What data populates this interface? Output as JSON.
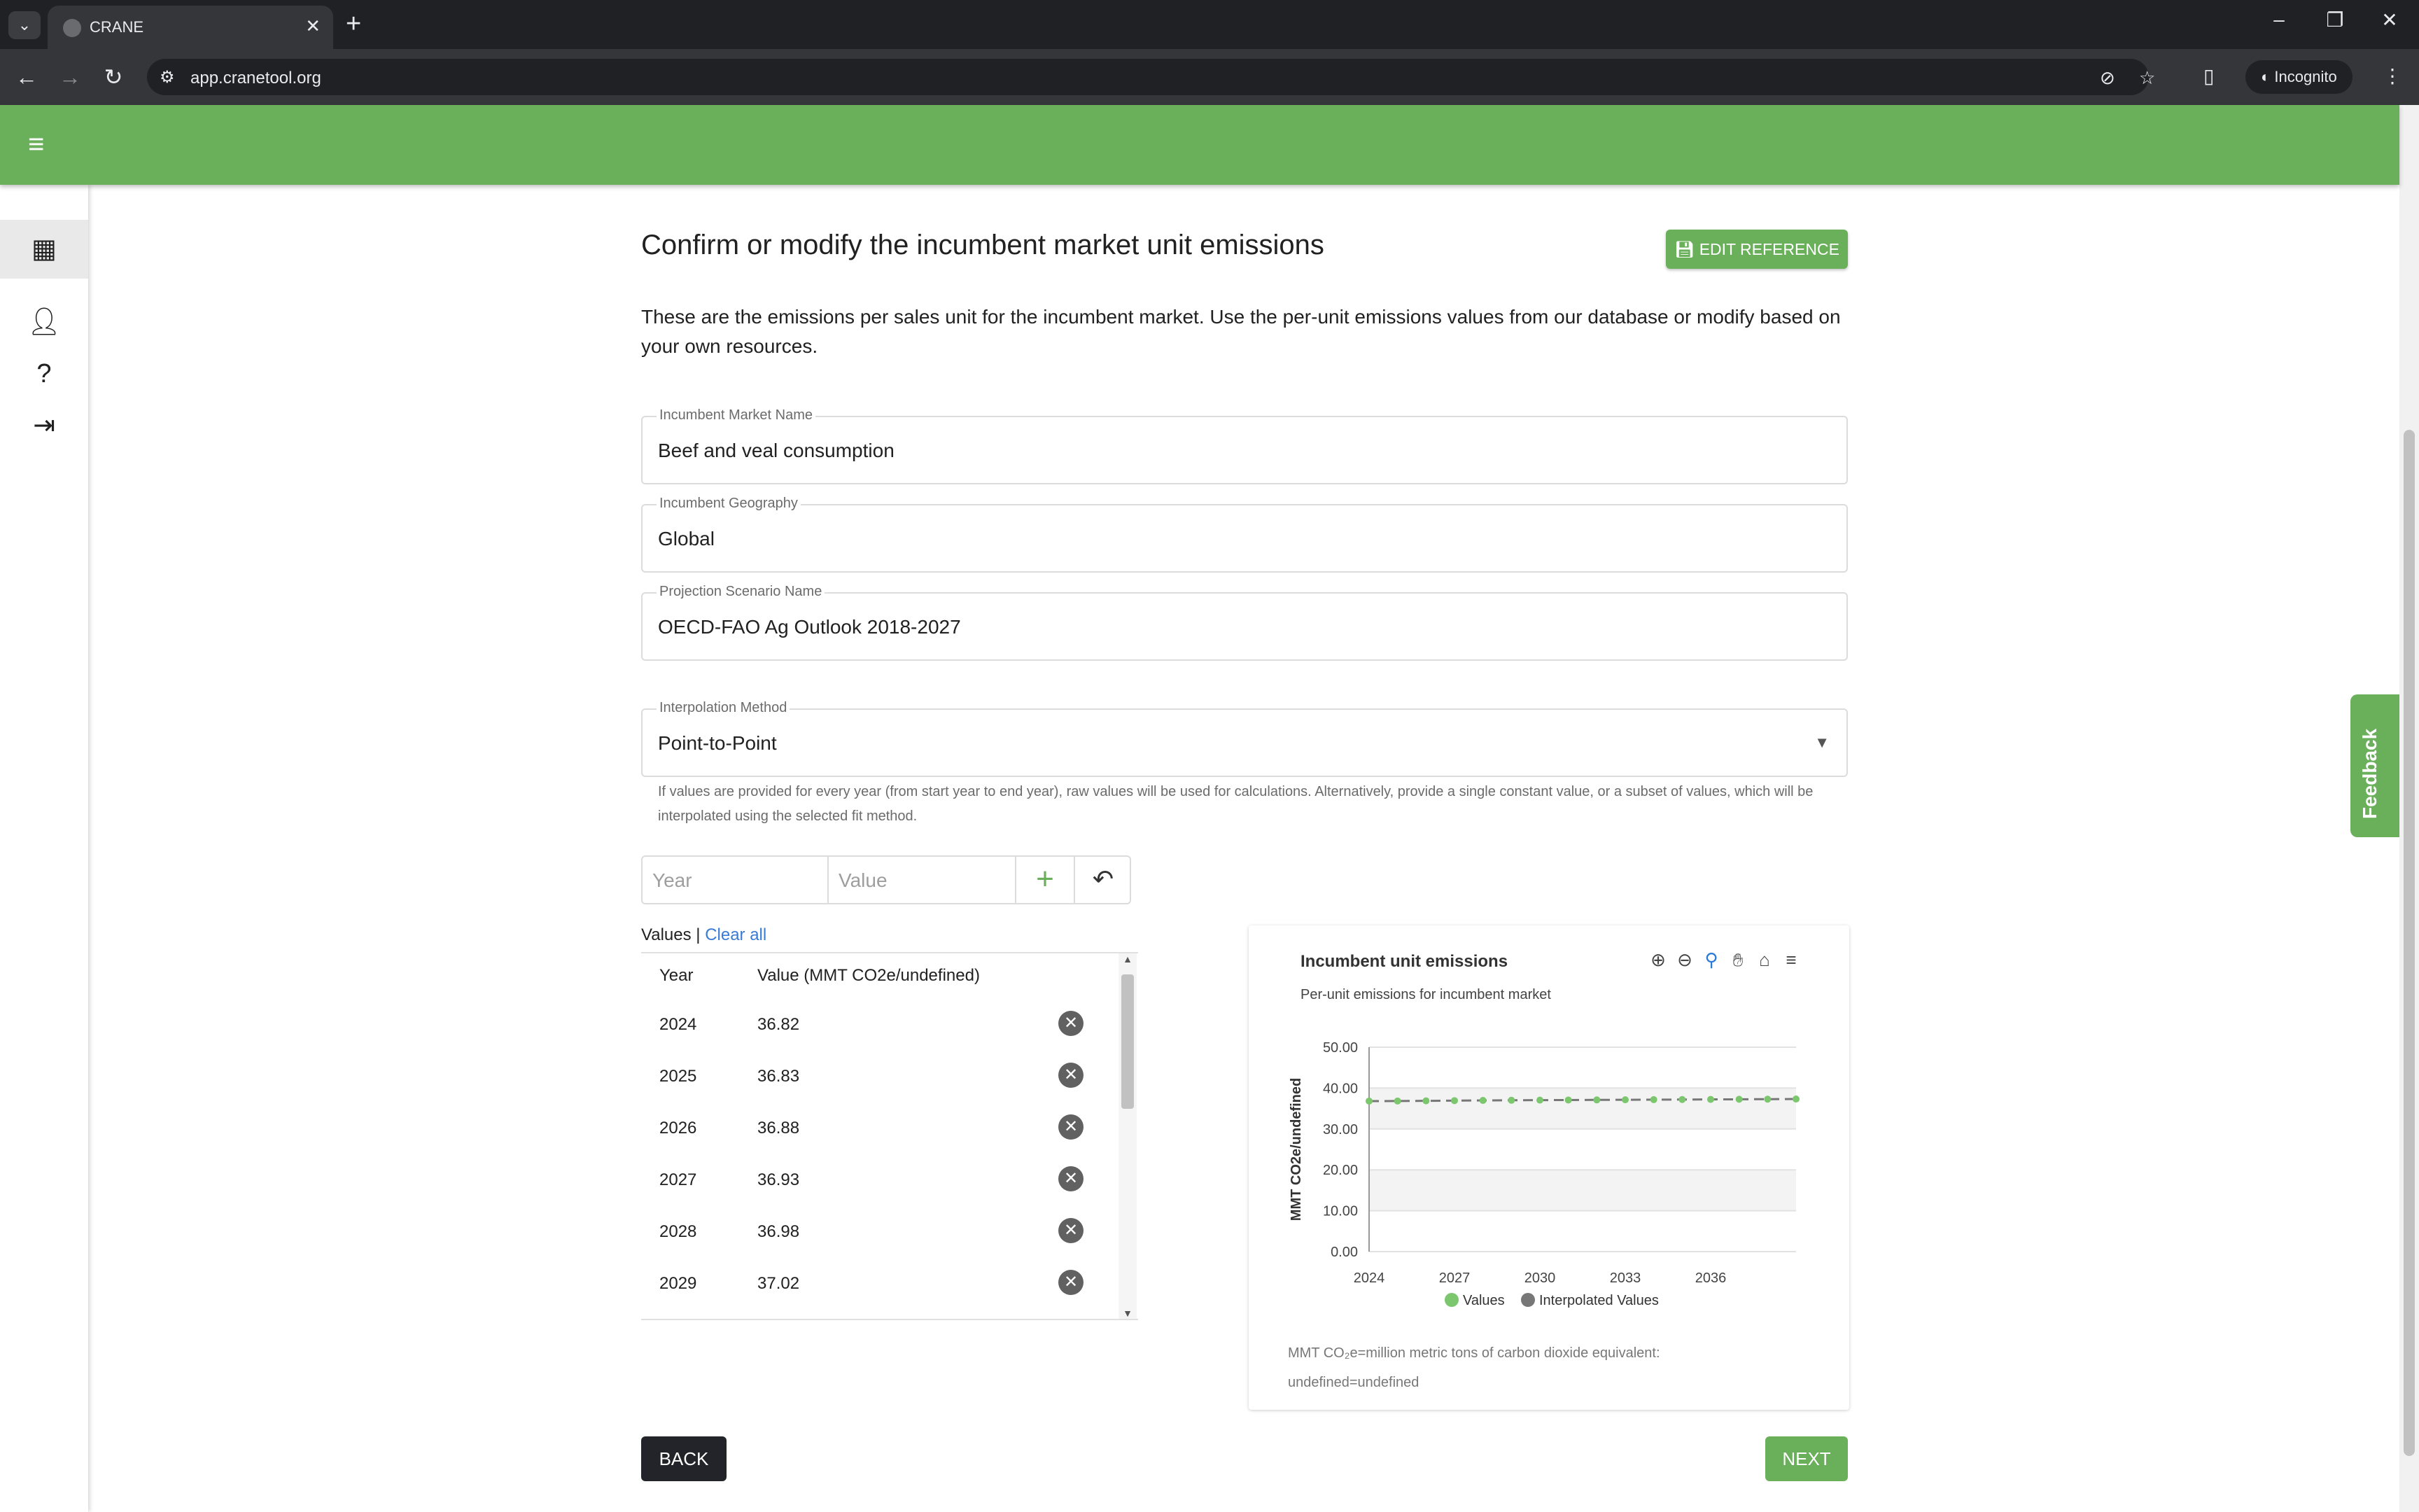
{
  "browser": {
    "tab_title": "CRANE",
    "tab_close": "✕",
    "new_tab": "+",
    "url": "app.cranetool.org",
    "incognito_label": "Incognito"
  },
  "page": {
    "title": "Confirm or modify the incumbent market unit emissions",
    "edit_reference_label": "EDIT REFERENCE",
    "description": "These are the emissions per sales unit for the incumbent market. Use the per-unit emissions values from our database or modify based on your own resources.",
    "fields": [
      {
        "label": "Incumbent Market Name",
        "value": "Beef and veal consumption"
      },
      {
        "label": "Incumbent Geography",
        "value": "Global"
      },
      {
        "label": "Projection Scenario Name",
        "value": "OECD-FAO Ag Outlook 2018-2027"
      }
    ],
    "interpolation": {
      "label": "Interpolation Method",
      "value": "Point-to-Point"
    },
    "help_text": "If values are provided for every year (from start year to end year), raw values will be used for calculations. Alternatively, provide a single constant value, or a subset of values, which will be interpolated using the selected fit method.",
    "entry": {
      "year_placeholder": "Year",
      "value_placeholder": "Value"
    },
    "values_header": {
      "label": "Values",
      "separator": " | ",
      "clear_all": "Clear all"
    },
    "table": {
      "col_year": "Year",
      "col_value": "Value (MMT CO2e/undefined)",
      "rows": [
        {
          "year": "2024",
          "value": "36.82"
        },
        {
          "year": "2025",
          "value": "36.83"
        },
        {
          "year": "2026",
          "value": "36.88"
        },
        {
          "year": "2027",
          "value": "36.93"
        },
        {
          "year": "2028",
          "value": "36.98"
        },
        {
          "year": "2029",
          "value": "37.02"
        }
      ]
    },
    "back_label": "BACK",
    "next_label": "NEXT",
    "feedback_label": "Feedback"
  },
  "chart_data": {
    "type": "line",
    "title": "Incumbent unit emissions",
    "subtitle": "Per-unit emissions for incumbent market",
    "ylabel": "MMT CO2e/undefined",
    "ylim": [
      0,
      50
    ],
    "yticks": [
      "0.00",
      "10.00",
      "20.00",
      "30.00",
      "40.00",
      "50.00"
    ],
    "xlim": [
      2024,
      2039
    ],
    "xticks": [
      "2024",
      "2027",
      "2030",
      "2033",
      "2036"
    ],
    "grid": true,
    "legend_position": "bottom",
    "series": [
      {
        "name": "Values",
        "color": "#7cc66e",
        "x": [
          2024,
          2025,
          2026,
          2027,
          2028,
          2029,
          2030,
          2031,
          2032,
          2033,
          2034,
          2035,
          2036,
          2037,
          2038,
          2039
        ],
        "values": [
          36.82,
          36.83,
          36.88,
          36.93,
          36.98,
          37.02,
          37.05,
          37.08,
          37.11,
          37.14,
          37.17,
          37.2,
          37.23,
          37.26,
          37.29,
          37.32
        ]
      },
      {
        "name": "Interpolated Values",
        "color": "#777777",
        "x": [],
        "values": []
      }
    ],
    "note_line1": "MMT CO₂e=million metric tons of carbon dioxide equivalent:",
    "note_line2": "undefined=undefined"
  }
}
